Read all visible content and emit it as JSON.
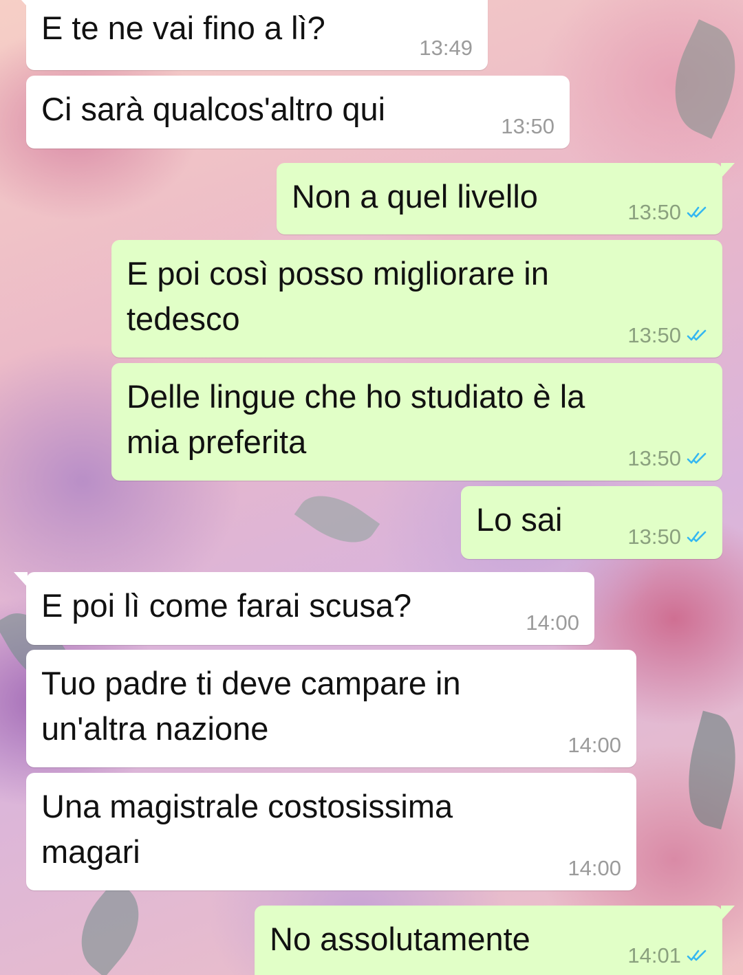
{
  "chat": {
    "messages": [
      {
        "direction": "in",
        "text": "E te ne vai fino a lì?",
        "time": "13:49"
      },
      {
        "direction": "in",
        "text": "Ci sarà qualcos'altro qui",
        "time": "13:50"
      },
      {
        "direction": "out",
        "text": "Non a quel livello",
        "time": "13:50",
        "status_icon": "double-check-read-icon"
      },
      {
        "direction": "out",
        "text": "E poi così posso migliorare in\ntedesco",
        "time": "13:50",
        "status_icon": "double-check-read-icon"
      },
      {
        "direction": "out",
        "text": "Delle lingue che ho studiato è la\nmia preferita",
        "time": "13:50",
        "status_icon": "double-check-read-icon"
      },
      {
        "direction": "out",
        "text": "Lo sai",
        "time": "13:50",
        "status_icon": "double-check-read-icon"
      },
      {
        "direction": "in",
        "text": "E poi lì come farai scusa?",
        "time": "14:00"
      },
      {
        "direction": "in",
        "text": "Tuo padre ti deve campare in\nun'altra nazione",
        "time": "14:00"
      },
      {
        "direction": "in",
        "text": "Una magistrale costosissima\nmagari",
        "time": "14:00"
      },
      {
        "direction": "out",
        "text": "No assolutamente",
        "time": "14:01",
        "status_icon": "double-check-read-icon"
      }
    ]
  },
  "colors": {
    "incoming_bubble": "#ffffff",
    "outgoing_bubble": "#e1ffc7",
    "read_tick": "#34b7f1"
  }
}
